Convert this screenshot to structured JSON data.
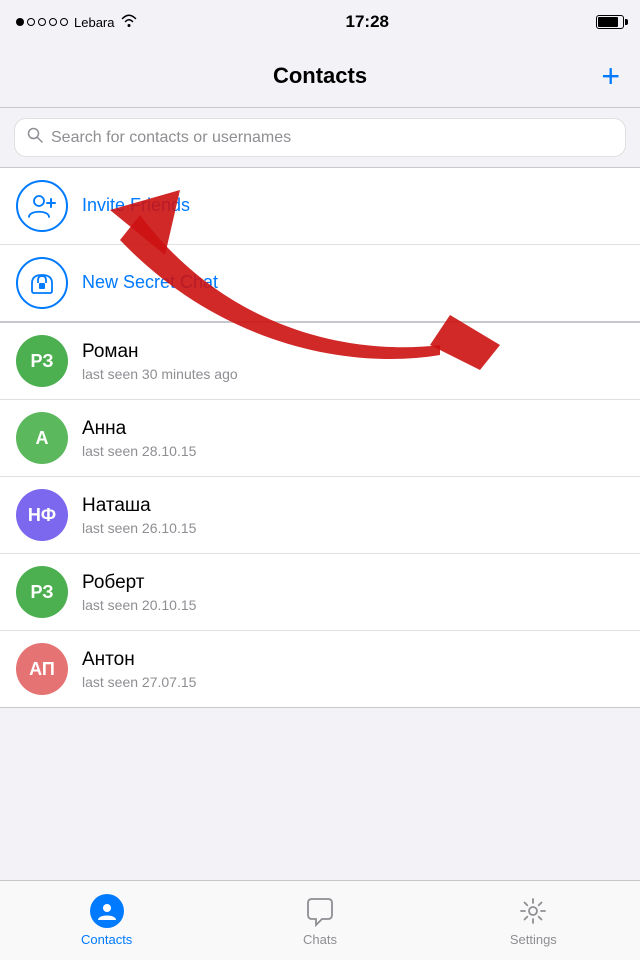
{
  "statusBar": {
    "carrier": "Lebara",
    "time": "17:28",
    "signal": [
      true,
      false,
      false,
      false,
      false
    ]
  },
  "navBar": {
    "title": "Contacts",
    "addButton": "+"
  },
  "search": {
    "placeholder": "Search for contacts or usernames"
  },
  "quickActions": [
    {
      "id": "invite-friends",
      "label": "Invite Friends",
      "type": "person-add"
    },
    {
      "id": "new-secret-chat",
      "label": "New Secret Chat",
      "type": "lock-chat"
    }
  ],
  "contacts": [
    {
      "id": 1,
      "initials": "РЗ",
      "name": "Роман",
      "subtitle": "last seen 30 minutes ago",
      "color": "green-1"
    },
    {
      "id": 2,
      "initials": "А",
      "name": "Анна",
      "subtitle": "last seen 28.10.15",
      "color": "green-2"
    },
    {
      "id": 3,
      "initials": "НФ",
      "name": "Наташа",
      "subtitle": "last seen 26.10.15",
      "color": "purple-1"
    },
    {
      "id": 4,
      "initials": "РЗ",
      "name": "Роберт",
      "subtitle": "last seen 20.10.15",
      "color": "green-1"
    },
    {
      "id": 5,
      "initials": "АП",
      "name": "Антон",
      "subtitle": "last seen 27.07.15",
      "color": "pink-1"
    }
  ],
  "tabBar": {
    "tabs": [
      {
        "id": "contacts",
        "label": "Contacts",
        "active": true
      },
      {
        "id": "chats",
        "label": "Chats",
        "active": false
      },
      {
        "id": "settings",
        "label": "Settings",
        "active": false
      }
    ]
  }
}
